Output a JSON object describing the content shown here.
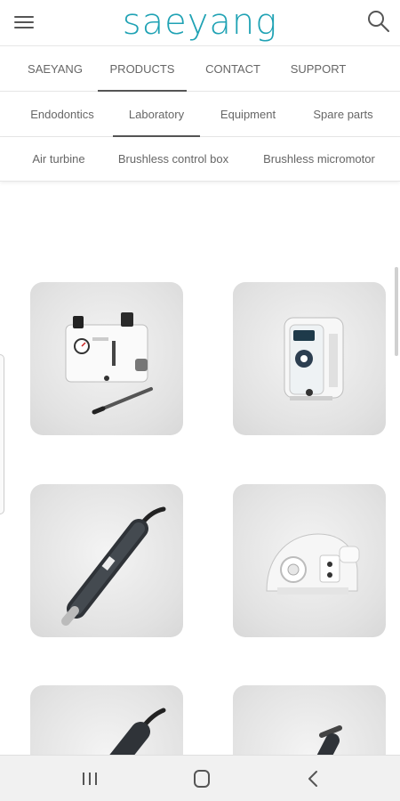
{
  "header": {
    "logo_text": "saeyang",
    "logo_color": "#1fa2b4",
    "menu_icon": "hamburger-menu-icon",
    "search_icon": "search-icon"
  },
  "main_nav": [
    {
      "label": "SAEYANG",
      "active": false
    },
    {
      "label": "PRODUCTS",
      "active": true
    },
    {
      "label": "CONTACT",
      "active": false
    },
    {
      "label": "SUPPORT",
      "active": false
    }
  ],
  "category_nav": [
    {
      "label": "Endodontics",
      "active": false
    },
    {
      "label": "Laboratory",
      "active": true
    },
    {
      "label": "Equipment",
      "active": false
    },
    {
      "label": "Spare parts",
      "active": false
    }
  ],
  "sub_nav": [
    {
      "label": "Air turbine"
    },
    {
      "label": "Brushless control box"
    },
    {
      "label": "Brushless micromotor"
    }
  ],
  "products": [
    {
      "icon": "laboratory-unit-with-handpiece-image"
    },
    {
      "icon": "control-box-image"
    },
    {
      "icon": "micromotor-handpiece-image"
    },
    {
      "icon": "dome-control-unit-image"
    },
    {
      "icon": "handpiece-image"
    },
    {
      "icon": "handpiece-image"
    }
  ],
  "system_nav": {
    "recent_icon": "recent-apps-icon",
    "home_icon": "home-icon",
    "back_icon": "back-icon"
  }
}
